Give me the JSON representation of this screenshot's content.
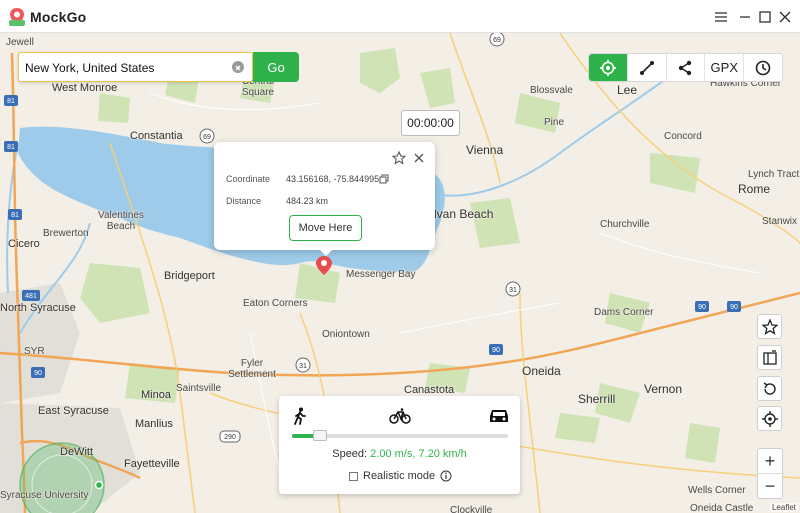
{
  "app": {
    "name": "MockGo",
    "window_controls": [
      "menu-icon",
      "minimize-icon",
      "maximize-icon",
      "close-icon"
    ]
  },
  "search": {
    "value": "New York, United States",
    "go_label": "Go"
  },
  "toolbar": {
    "modes": [
      {
        "name": "teleport-mode",
        "icon": "crosshair-icon",
        "active": true
      },
      {
        "name": "two-spot-mode",
        "icon": "route-icon"
      },
      {
        "name": "share",
        "icon": "share-icon"
      },
      {
        "name": "gpx",
        "label": "GPX"
      },
      {
        "name": "history",
        "icon": "clock-icon"
      }
    ],
    "accent": "#2fb24c"
  },
  "timer": "00:00:00",
  "popup": {
    "coordinate_label": "Coordinate",
    "coordinate_value": "43.156168, -75.844995",
    "distance_label": "Distance",
    "distance_value": "484.23 km",
    "move_label": "Move Here"
  },
  "map": {
    "places": [
      {
        "name": "West Monroe"
      },
      {
        "name": "Constantia"
      },
      {
        "name": "Central Square"
      },
      {
        "name": "Brewerton"
      },
      {
        "name": "Cicero"
      },
      {
        "name": "Valentines Beach"
      },
      {
        "name": "Bridgeport"
      },
      {
        "name": "North Syracuse"
      },
      {
        "name": "SYR"
      },
      {
        "name": "Eaton Corners"
      },
      {
        "name": "Oniontown"
      },
      {
        "name": "Fyler Settlement"
      },
      {
        "name": "Saintsville"
      },
      {
        "name": "Minoa"
      },
      {
        "name": "East Syracuse"
      },
      {
        "name": "Manlius"
      },
      {
        "name": "Fayetteville"
      },
      {
        "name": "DeWitt"
      },
      {
        "name": "Syracuse University"
      },
      {
        "name": "Jewell"
      },
      {
        "name": "Vienna"
      },
      {
        "name": "Sylvan Beach"
      },
      {
        "name": "Messenger Bay"
      },
      {
        "name": "Canastota"
      },
      {
        "name": "Oneida"
      },
      {
        "name": "Sherrill"
      },
      {
        "name": "Vernon"
      },
      {
        "name": "Rome"
      },
      {
        "name": "Blossvale"
      },
      {
        "name": "Pine"
      },
      {
        "name": "Lee"
      },
      {
        "name": "Hawkins Corner"
      },
      {
        "name": "Concord"
      },
      {
        "name": "Lynch Tract"
      },
      {
        "name": "Stanwix"
      },
      {
        "name": "Churchville"
      },
      {
        "name": "Dams Corner"
      },
      {
        "name": "Wells Corner"
      },
      {
        "name": "Clockville"
      },
      {
        "name": "Oneida Castle"
      }
    ],
    "route_shields": [
      "69",
      "69",
      "31",
      "31",
      "90",
      "90",
      "90",
      "290",
      "481",
      "81"
    ],
    "attribution": "Leaflet"
  },
  "side_tools": [
    "star-icon",
    "map-layers-icon",
    "reset-icon",
    "locate-icon"
  ],
  "zoom": {
    "in": "+",
    "out": "−"
  },
  "speed_panel": {
    "modes": [
      "walk-icon",
      "bicycle-icon",
      "car-icon"
    ],
    "speed_label": "Speed: ",
    "speed_value": "2.00 m/s, 7.20 km/h",
    "slider_level": 0.13,
    "realistic_label": "Realistic mode"
  }
}
